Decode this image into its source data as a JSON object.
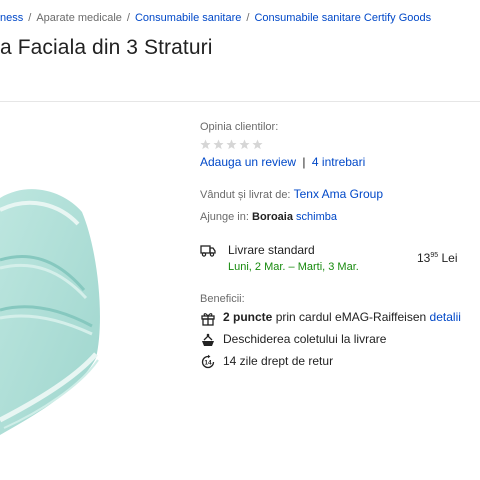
{
  "breadcrumb": {
    "items": [
      {
        "label": "ness",
        "link": true
      },
      {
        "label": "Aparate medicale",
        "link": false
      },
      {
        "label": "Consumabile sanitare",
        "link": true
      },
      {
        "label": "Consumabile sanitare Certify Goods",
        "link": true
      }
    ],
    "separator": "/"
  },
  "product": {
    "title": "a Faciala din 3 Straturi"
  },
  "reviews": {
    "label": "Opinia clientilor:",
    "rating": 0,
    "max_rating": 5,
    "add_review": "Adauga un review",
    "divider": "|",
    "questions": "4 intrebari"
  },
  "seller": {
    "label": "Vândut și livrat de:",
    "name": "Tenx Ama Group"
  },
  "delivery": {
    "arrives_label": "Ajunge in:",
    "location": "Boroaia",
    "change": "schimba",
    "standard_label": "Livrare standard",
    "dates": "Luni, 2 Mar. – Marti, 3 Mar.",
    "price_int": "13",
    "price_dec": "95",
    "currency": "Lei"
  },
  "benefits": {
    "label": "Beneficii:",
    "points_bold": "2 puncte",
    "points_text": "prin cardul eMAG-Raiffeisen",
    "points_link": "detalii",
    "open_package": "Deschiderea coletului la livrare",
    "return_badge": "14",
    "return_text": "14 zile drept de retur"
  },
  "colors": {
    "link": "#0048c8",
    "green": "#178a0e",
    "mask": "#a9ddd6"
  }
}
